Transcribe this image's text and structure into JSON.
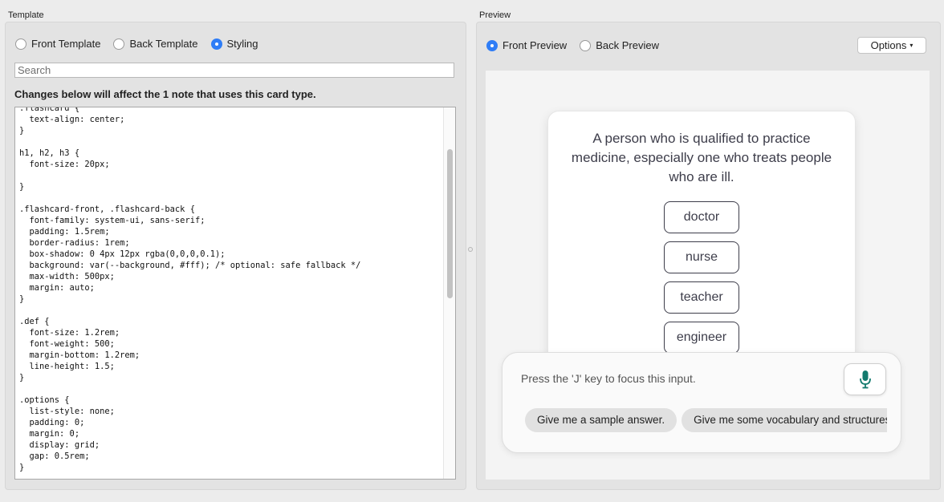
{
  "template_panel": {
    "title": "Template",
    "radios": [
      {
        "label": "Front Template",
        "selected": false
      },
      {
        "label": "Back Template",
        "selected": false
      },
      {
        "label": "Styling",
        "selected": true
      }
    ],
    "search_placeholder": "Search",
    "notice": "Changes below will affect the 1 note that uses this card type.",
    "code": ".flashcard {\n  text-align: center;\n}\n\nh1, h2, h3 {\n  font-size: 20px;\n\n}\n\n.flashcard-front, .flashcard-back {\n  font-family: system-ui, sans-serif;\n  padding: 1.5rem;\n  border-radius: 1rem;\n  box-shadow: 0 4px 12px rgba(0,0,0,0.1);\n  background: var(--background, #fff); /* optional: safe fallback */\n  max-width: 500px;\n  margin: auto;\n}\n\n.def {\n  font-size: 1.2rem;\n  font-weight: 500;\n  margin-bottom: 1.2rem;\n  line-height: 1.5;\n}\n\n.options {\n  list-style: none;\n  padding: 0;\n  margin: 0;\n  display: grid;\n  gap: 0.5rem;\n}"
  },
  "preview_panel": {
    "title": "Preview",
    "radios": [
      {
        "label": "Front Preview",
        "selected": true
      },
      {
        "label": "Back Preview",
        "selected": false
      }
    ],
    "options_label": "Options",
    "card": {
      "definition": "A person who is qualified to practice medicine, especially one who treats people who are ill.",
      "options": [
        "doctor",
        "nurse",
        "teacher",
        "engineer"
      ]
    },
    "chat": {
      "placeholder": "Press the 'J' key to focus this input.",
      "mic_icon": "microphone-icon",
      "suggestions": [
        "Give me a sample answer.",
        "Give me some vocabulary and structures"
      ]
    }
  },
  "colors": {
    "accent": "#2f7df6",
    "mic": "#127a6e",
    "card_text": "#3d3d4a"
  }
}
